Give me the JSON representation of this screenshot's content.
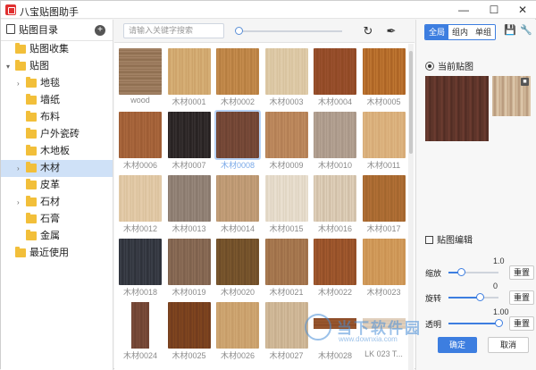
{
  "window": {
    "title": "八宝贴图助手",
    "controls": [
      "minimize",
      "maximize",
      "close"
    ]
  },
  "sidebar": {
    "header": "贴图目录",
    "items": [
      {
        "label": "贴图收集",
        "level": 0,
        "caret": false,
        "selected": false
      },
      {
        "label": "贴图",
        "level": 0,
        "caret": true,
        "selected": false
      },
      {
        "label": "地毯",
        "level": 1,
        "caret": true,
        "selected": false
      },
      {
        "label": "墙纸",
        "level": 1,
        "caret": false,
        "selected": false
      },
      {
        "label": "布料",
        "level": 1,
        "caret": false,
        "selected": false
      },
      {
        "label": "户外瓷砖",
        "level": 1,
        "caret": false,
        "selected": false
      },
      {
        "label": "木地板",
        "level": 1,
        "caret": false,
        "selected": false
      },
      {
        "label": "木材",
        "level": 1,
        "caret": true,
        "selected": true
      },
      {
        "label": "皮革",
        "level": 1,
        "caret": false,
        "selected": false
      },
      {
        "label": "石材",
        "level": 1,
        "caret": true,
        "selected": false
      },
      {
        "label": "石膏",
        "level": 1,
        "caret": false,
        "selected": false
      },
      {
        "label": "金属",
        "level": 1,
        "caret": false,
        "selected": false
      },
      {
        "label": "最近使用",
        "level": 0,
        "caret": false,
        "selected": false
      }
    ]
  },
  "toolbar": {
    "search_placeholder": "请输入关键字搜索",
    "zoom_level": 0,
    "icons": [
      "refresh-icon",
      "picker-icon"
    ]
  },
  "textures": [
    {
      "name": "wood",
      "c1": "#8a6a4c",
      "c2": "#a8876a",
      "stripe": "h"
    },
    {
      "name": "木材0001",
      "c1": "#d9b27a",
      "c2": "#caa066",
      "stripe": "v"
    },
    {
      "name": "木材0002",
      "c1": "#b27a3e",
      "c2": "#c99050",
      "stripe": "v"
    },
    {
      "name": "木材0003",
      "c1": "#e2cfae",
      "c2": "#d6c09b",
      "stripe": "v"
    },
    {
      "name": "木材0004",
      "c1": "#8d4722",
      "c2": "#9c5230",
      "stripe": "v"
    },
    {
      "name": "木材0005",
      "c1": "#a85f22",
      "c2": "#c27a34",
      "stripe": "v"
    },
    {
      "name": "木材0006",
      "c1": "#9a5a32",
      "c2": "#ad6a40",
      "stripe": "v"
    },
    {
      "name": "木材0007",
      "c1": "#231e1e",
      "c2": "#3a3333",
      "stripe": "v"
    },
    {
      "name": "木材0008",
      "c1": "#6a4030",
      "c2": "#7d4e3c",
      "stripe": "v"
    },
    {
      "name": "木材0009",
      "c1": "#b07c52",
      "c2": "#c28e62",
      "stripe": "v"
    },
    {
      "name": "木材0010",
      "c1": "#a59384",
      "c2": "#b8a697",
      "stripe": "v"
    },
    {
      "name": "木材0011",
      "c1": "#d4a873",
      "c2": "#e0b885",
      "stripe": "v"
    },
    {
      "name": "木材0012",
      "c1": "#e6cfae",
      "c2": "#d9bf9a",
      "stripe": "v"
    },
    {
      "name": "木材0013",
      "c1": "#86766a",
      "c2": "#9a8a7e",
      "stripe": "v"
    },
    {
      "name": "木材0014",
      "c1": "#b4916c",
      "c2": "#c8a27c",
      "stripe": "v"
    },
    {
      "name": "木材0015",
      "c1": "#ece3d4",
      "c2": "#ddd1bf",
      "stripe": "v"
    },
    {
      "name": "木材0016",
      "c1": "#cdbba3",
      "c2": "#e3d4bf",
      "stripe": "v"
    },
    {
      "name": "木材0017",
      "c1": "#a0642c",
      "c2": "#b47238",
      "stripe": "v"
    },
    {
      "name": "木材0018",
      "c1": "#2b2e36",
      "c2": "#3f434d",
      "stripe": "v"
    },
    {
      "name": "木材0019",
      "c1": "#7a5e4a",
      "c2": "#8f705a",
      "stripe": "v"
    },
    {
      "name": "木材0020",
      "c1": "#6a4a26",
      "c2": "#7e5a30",
      "stripe": "v"
    },
    {
      "name": "木材0021",
      "c1": "#9a6c45",
      "c2": "#ad7e55",
      "stripe": "v"
    },
    {
      "name": "木材0022",
      "c1": "#8e4c26",
      "c2": "#a65c30",
      "stripe": "v"
    },
    {
      "name": "木材0023",
      "c1": "#c89050",
      "c2": "#d6a060",
      "stripe": "v"
    },
    {
      "name": "木材0024",
      "c1": "#6b4030",
      "c2": "#7e4e3c",
      "stripe": "v",
      "inset": true
    },
    {
      "name": "木材0025",
      "c1": "#6e3a1e",
      "c2": "#84481f",
      "stripe": "v"
    },
    {
      "name": "木材0026",
      "c1": "#c49a66",
      "c2": "#d2aa76",
      "stripe": "v"
    },
    {
      "name": "木材0027",
      "c1": "#c4ab8a",
      "c2": "#d6bf9f",
      "stripe": "v"
    },
    {
      "name": "木材0028",
      "c1": "#8a4a26",
      "c2": "#9c5a30",
      "stripe": "h",
      "inset": true
    },
    {
      "name": "LK 023 T...",
      "c1": "#e4d4c2",
      "c2": "#d6c4b0",
      "stripe": "h",
      "inset": true
    }
  ],
  "panel": {
    "tabs": [
      {
        "label": "全局",
        "active": true
      },
      {
        "label": "组内",
        "active": false
      },
      {
        "label": "单组",
        "active": false
      }
    ],
    "current_label": "当前贴图",
    "edit_label": "贴图编辑",
    "props": [
      {
        "label": "缩放",
        "value": "1.0",
        "level": 0.25
      },
      {
        "label": "旋转",
        "value": "0",
        "level": 0.62
      },
      {
        "label": "透明",
        "value": "1.00",
        "level": 1.0
      }
    ],
    "reset_label": "重置",
    "ok_label": "确定",
    "cancel_label": "取消"
  },
  "watermark": {
    "text": "当下软件园",
    "url": "www.downxia.com"
  },
  "colors": {
    "accent": "#3d7ee0",
    "folder": "#f2bf3a"
  }
}
